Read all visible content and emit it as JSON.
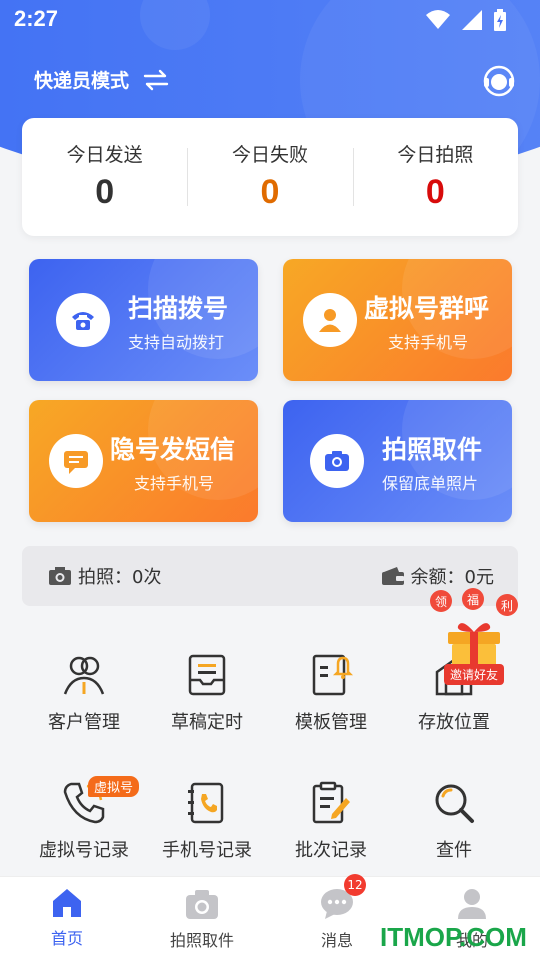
{
  "status_bar": {
    "time": "2:27",
    "icons": [
      "wifi-icon",
      "signal-icon",
      "battery-icon"
    ]
  },
  "header": {
    "mode_label": "快递员模式",
    "swap_icon": "swap-icon",
    "support_icon": "headset-icon"
  },
  "stats": [
    {
      "label": "今日发送",
      "value": "0",
      "color": "#333333"
    },
    {
      "label": "今日失败",
      "value": "0",
      "color": "#e06b00"
    },
    {
      "label": "今日拍照",
      "value": "0",
      "color": "#d80b0b"
    }
  ],
  "features": [
    {
      "title": "扫描拨号",
      "subtitle": "支持自动拨打",
      "icon": "phone-icon",
      "theme": "blue"
    },
    {
      "title": "虚拟号群呼",
      "subtitle": "支持手机号",
      "icon": "person-icon",
      "theme": "orange"
    },
    {
      "title": "隐号发短信",
      "subtitle": "支持手机号",
      "icon": "sms-icon",
      "theme": "orange"
    },
    {
      "title": "拍照取件",
      "subtitle": "保留底单照片",
      "icon": "camera-icon",
      "theme": "blue"
    }
  ],
  "info_bar": {
    "photo_text": "拍照：0次",
    "balance_text": "余额：0元"
  },
  "grid": [
    {
      "label": "客户管理",
      "icon": "customers-icon"
    },
    {
      "label": "草稿定时",
      "icon": "draft-inbox-icon"
    },
    {
      "label": "模板管理",
      "icon": "template-icon"
    },
    {
      "label": "存放位置",
      "icon": "storage-location-icon"
    },
    {
      "label": "虚拟号记录",
      "icon": "phone-record-icon"
    },
    {
      "label": "手机号记录",
      "icon": "phone-book-icon"
    },
    {
      "label": "批次记录",
      "icon": "batch-edit-icon"
    },
    {
      "label": "查件",
      "icon": "search-icon"
    }
  ],
  "virtual_badge": "虚拟号",
  "gift": {
    "chars": [
      "领",
      "福",
      "利"
    ],
    "invite": "邀请好友"
  },
  "nav": [
    {
      "label": "首页",
      "icon": "home-icon",
      "active": true
    },
    {
      "label": "拍照取件",
      "icon": "camera-icon",
      "active": false
    },
    {
      "label": "消息",
      "icon": "chat-icon",
      "active": false
    },
    {
      "label": "我的",
      "icon": "user-icon",
      "active": false
    }
  ],
  "message_badge": "12",
  "watermark": "ITMOP.COM",
  "colors": {
    "primary_blue": "#3d63f0",
    "orange": "#fb7a2c",
    "fail": "#e06b00",
    "photo": "#d80b0b"
  }
}
